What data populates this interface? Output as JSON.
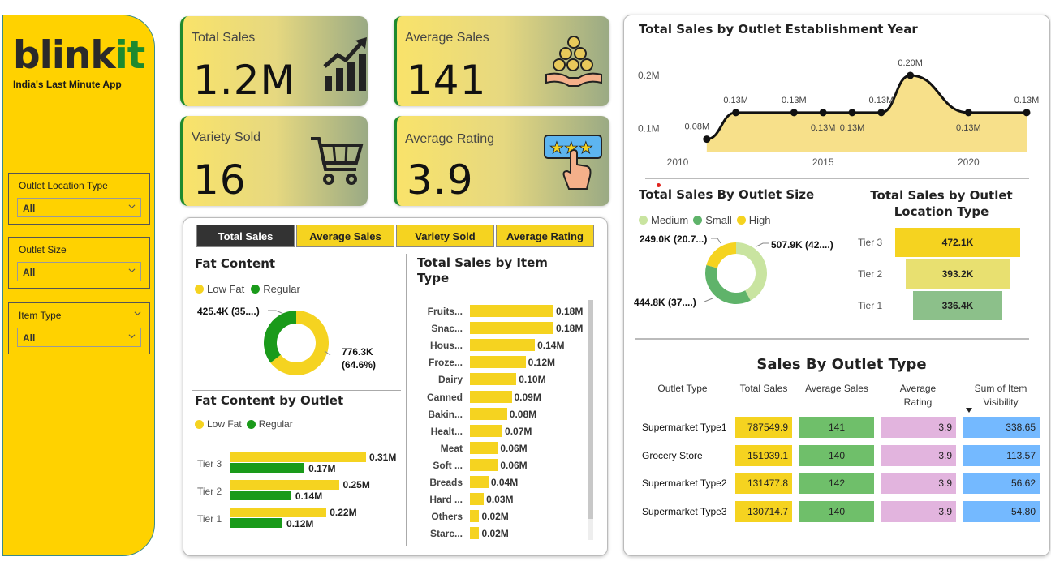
{
  "brand": {
    "logo_main": "blink",
    "logo_accent": "it",
    "tagline": "India's Last Minute App"
  },
  "filters": [
    {
      "label": "Outlet Location Type",
      "value": "All"
    },
    {
      "label": "Outlet Size",
      "value": "All"
    },
    {
      "label": "Item Type",
      "value": "All"
    }
  ],
  "kpis": {
    "total_sales": {
      "label": "Total Sales",
      "value": "1.2M"
    },
    "average_sales": {
      "label": "Average Sales",
      "value": "141"
    },
    "variety_sold": {
      "label": "Variety Sold",
      "value": "16"
    },
    "average_rating": {
      "label": "Average Rating",
      "value": "3.9"
    }
  },
  "tabs": [
    "Total Sales",
    "Average Sales",
    "Variety Sold",
    "Average Rating"
  ],
  "fat_content": {
    "title": "Fat Content",
    "legend": [
      "Low Fat",
      "Regular"
    ],
    "regular_label": "425.4K (35....)",
    "lowfat_label_1": "776.3K",
    "lowfat_label_2": "(64.6%)"
  },
  "fat_by_outlet": {
    "title": "Fat Content by Outlet",
    "legend": [
      "Low Fat",
      "Regular"
    ]
  },
  "item_type": {
    "title_1": "Total Sales by Item",
    "title_2": "Type"
  },
  "year_chart": {
    "title": "Total Sales by Outlet Establishment Year"
  },
  "outlet_size": {
    "title": "Total Sales By Outlet Size",
    "legend": [
      "Medium",
      "Small",
      "High"
    ],
    "label_high": "249.0K (20.7...)",
    "label_medium": "507.9K (42....)",
    "label_small": "444.8K (37....)"
  },
  "location_type": {
    "title_1": "Total Sales by Outlet",
    "title_2": "Location Type"
  },
  "outlet_type": {
    "title": "Sales By Outlet Type",
    "headers": [
      "Outlet Type",
      "Total Sales",
      "Average Sales",
      "Average",
      "Rating",
      "Sum of Item",
      "Visibility"
    ],
    "rows": [
      {
        "name": "Supermarket Type1",
        "total": "787549.9",
        "avg": "141",
        "rating": "3.9",
        "vis": "338.65"
      },
      {
        "name": "Grocery Store",
        "total": "151939.1",
        "avg": "140",
        "rating": "3.9",
        "vis": "113.57"
      },
      {
        "name": "Supermarket Type2",
        "total": "131477.8",
        "avg": "142",
        "rating": "3.9",
        "vis": "56.62"
      },
      {
        "name": "Supermarket Type3",
        "total": "130714.7",
        "avg": "140",
        "rating": "3.9",
        "vis": "54.80"
      }
    ]
  },
  "colors": {
    "yellow": "#f5d320",
    "green": "#1a9a1a",
    "light_green": "#8cc08a",
    "sidebar": "#ffd200",
    "dark_tab": "#333333",
    "pink": "#e2b4de",
    "blue": "#74b9ff",
    "table_green": "#6fbf6a"
  },
  "chart_data": [
    {
      "type": "line",
      "title": "Total Sales by Outlet Establishment Year",
      "x": [
        2011,
        2012,
        2014,
        2015,
        2016,
        2017,
        2018,
        2020,
        2022
      ],
      "y": [
        0.08,
        0.13,
        0.13,
        0.13,
        0.13,
        0.13,
        0.2,
        0.13,
        0.13
      ],
      "labels": [
        "0.08M",
        "0.13M",
        "0.13M",
        "0.13M",
        "0.13M",
        "0.13M",
        "0.20M",
        "0.13M",
        "0.13M"
      ],
      "xticks": [
        "2010",
        "2015",
        "2020"
      ],
      "yticks": [
        "0.1M",
        "0.2M"
      ],
      "xlim": [
        2010,
        2022
      ],
      "ylim": [
        0.055,
        0.235
      ]
    },
    {
      "type": "pie",
      "title": "Fat Content",
      "categories": [
        "Low Fat",
        "Regular"
      ],
      "values": [
        776.3,
        425.4
      ],
      "colors": [
        "#f5d320",
        "#1a9a1a"
      ]
    },
    {
      "type": "bar",
      "title": "Fat Content by Outlet",
      "categories": [
        "Tier 3",
        "Tier 2",
        "Tier 1"
      ],
      "series": [
        {
          "name": "Low Fat",
          "values": [
            0.31,
            0.25,
            0.22
          ],
          "labels": [
            "0.31M",
            "0.25M",
            "0.22M"
          ]
        },
        {
          "name": "Regular",
          "values": [
            0.17,
            0.14,
            0.12
          ],
          "labels": [
            "0.17M",
            "0.14M",
            "0.12M"
          ]
        }
      ]
    },
    {
      "type": "bar",
      "title": "Total Sales by Item Type",
      "categories": [
        "Fruits...",
        "Snac...",
        "Hous...",
        "Froze...",
        "Dairy",
        "Canned",
        "Bakin...",
        "Healt...",
        "Meat",
        "Soft ...",
        "Breads",
        "Hard ...",
        "Others",
        "Starc..."
      ],
      "values": [
        0.18,
        0.18,
        0.14,
        0.12,
        0.1,
        0.09,
        0.08,
        0.07,
        0.06,
        0.06,
        0.04,
        0.03,
        0.02,
        0.02
      ],
      "labels": [
        "0.18M",
        "0.18M",
        "0.14M",
        "0.12M",
        "0.10M",
        "0.09M",
        "0.08M",
        "0.07M",
        "0.06M",
        "0.06M",
        "0.04M",
        "0.03M",
        "0.02M",
        "0.02M"
      ]
    },
    {
      "type": "pie",
      "title": "Total Sales By Outlet Size",
      "categories": [
        "Medium",
        "Small",
        "High"
      ],
      "values": [
        507.9,
        444.8,
        249.0
      ],
      "colors": [
        "#c9e4a0",
        "#5fb36a",
        "#f5d320"
      ]
    },
    {
      "type": "bar",
      "title": "Total Sales by Outlet Location Type",
      "categories": [
        "Tier 3",
        "Tier 2",
        "Tier 1"
      ],
      "values": [
        472.1,
        393.2,
        336.4
      ],
      "labels": [
        "472.1K",
        "393.2K",
        "336.4K"
      ],
      "colors": [
        "#f5d320",
        "#e8e070",
        "#8cc08a"
      ]
    }
  ]
}
